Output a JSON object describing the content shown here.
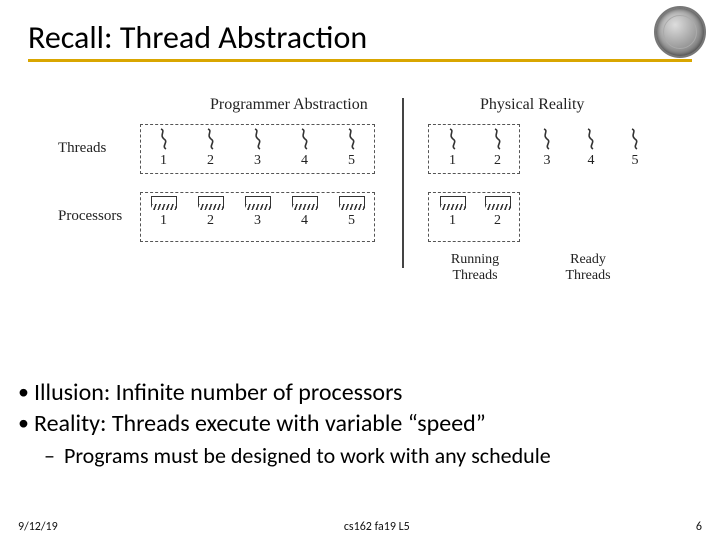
{
  "title": "Recall: Thread Abstraction",
  "diagram": {
    "left_header": "Programmer Abstraction",
    "right_header": "Physical Reality",
    "row_threads_label": "Threads",
    "row_procs_label": "Processors",
    "left_threads": [
      "1",
      "2",
      "3",
      "4",
      "5"
    ],
    "left_procs": [
      "1",
      "2",
      "3",
      "4",
      "5"
    ],
    "right_threads_running": [
      "1",
      "2"
    ],
    "right_threads_ready": [
      "3",
      "4",
      "5"
    ],
    "right_procs": [
      "1",
      "2"
    ],
    "running_label": "Running\nThreads",
    "ready_label": "Ready\nThreads"
  },
  "bullets": {
    "b1": "Illusion: Infinite number of processors",
    "b2": "Reality: Threads execute with variable “speed”",
    "b2a": "Programs must be designed to work with any schedule"
  },
  "footer": {
    "date": "9/12/19",
    "course": "cs162 fa19 L5",
    "page": "6"
  }
}
